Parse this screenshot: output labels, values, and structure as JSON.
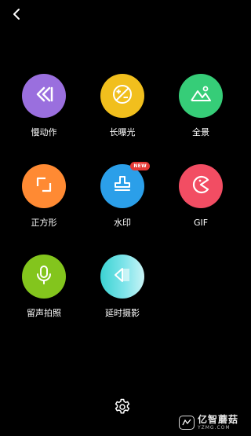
{
  "nav": {
    "back": "back-arrow-icon"
  },
  "modes": [
    {
      "id": "slow-motion",
      "label": "慢动作",
      "icon": "rewind-icon",
      "color": "#9a6fde"
    },
    {
      "id": "long-exposure",
      "label": "长曝光",
      "icon": "exposure-icon",
      "color": "#f1bf1d"
    },
    {
      "id": "panorama",
      "label": "全景",
      "icon": "mountain-icon",
      "color": "#36cd78"
    },
    {
      "id": "square",
      "label": "正方形",
      "icon": "square-frame-icon",
      "color": "#ff8a33"
    },
    {
      "id": "watermark",
      "label": "水印",
      "icon": "stamp-icon",
      "color": "#2b9fe9",
      "badge": "NEW",
      "badge_color": "#e53935"
    },
    {
      "id": "gif",
      "label": "GIF",
      "icon": "pacman-icon",
      "color": "#f24d63"
    },
    {
      "id": "voice-photo",
      "label": "留声拍照",
      "icon": "microphone-icon",
      "color": "#83c51d"
    },
    {
      "id": "timelapse",
      "label": "延时摄影",
      "icon": "timelapse-icon",
      "color": "#3bd3d2"
    }
  ],
  "footer": {
    "settings": "gear-icon"
  },
  "watermark": {
    "name": "亿智蘑菇",
    "domain": "YZMG.COM"
  }
}
